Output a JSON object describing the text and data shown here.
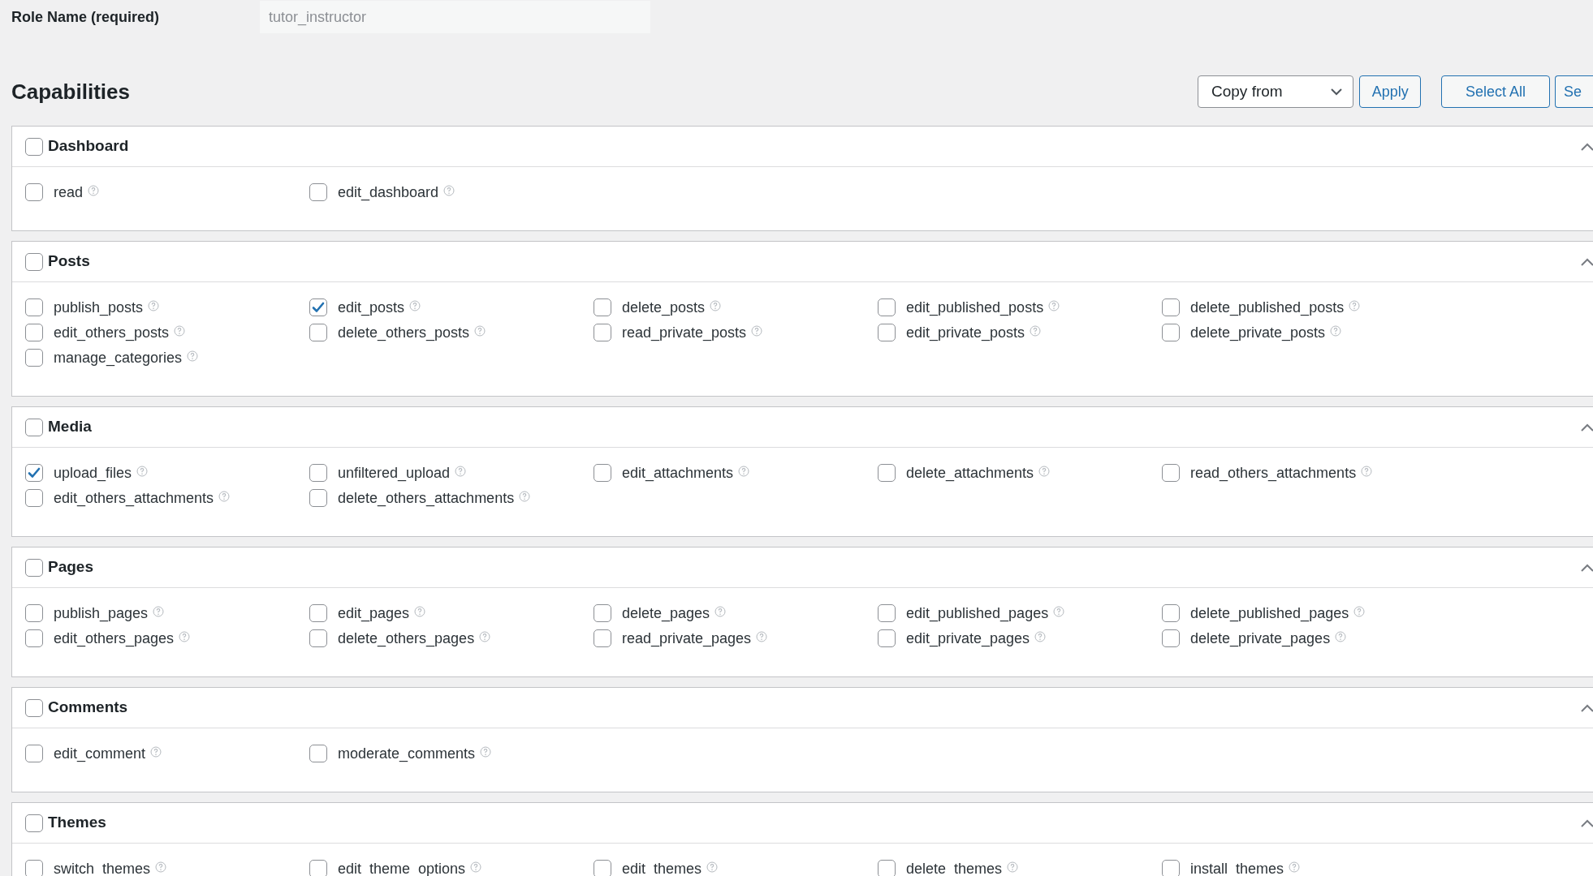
{
  "role_name": {
    "label": "Role Name (required)",
    "placeholder": "tutor_instructor"
  },
  "capabilities": {
    "title": "Capabilities",
    "copy_from": "Copy from",
    "apply": "Apply",
    "select_all": "Select All",
    "button_4": "Se"
  },
  "groups": [
    {
      "title": "Dashboard",
      "checked": false,
      "expanded": true,
      "items": [
        {
          "label": "read",
          "checked": false
        },
        {
          "label": "edit_dashboard",
          "checked": false
        }
      ]
    },
    {
      "title": "Posts",
      "checked": false,
      "expanded": true,
      "items": [
        {
          "label": "publish_posts",
          "checked": false
        },
        {
          "label": "edit_posts",
          "checked": true
        },
        {
          "label": "delete_posts",
          "checked": false
        },
        {
          "label": "edit_published_posts",
          "checked": false
        },
        {
          "label": "delete_published_posts",
          "checked": false
        },
        {
          "label": "edit_others_posts",
          "checked": false
        },
        {
          "label": "delete_others_posts",
          "checked": false
        },
        {
          "label": "read_private_posts",
          "checked": false
        },
        {
          "label": "edit_private_posts",
          "checked": false
        },
        {
          "label": "delete_private_posts",
          "checked": false
        },
        {
          "label": "manage_categories",
          "checked": false
        }
      ]
    },
    {
      "title": "Media",
      "checked": false,
      "expanded": true,
      "items": [
        {
          "label": "upload_files",
          "checked": true
        },
        {
          "label": "unfiltered_upload",
          "checked": false
        },
        {
          "label": "edit_attachments",
          "checked": false
        },
        {
          "label": "delete_attachments",
          "checked": false
        },
        {
          "label": "read_others_attachments",
          "checked": false
        },
        {
          "label": "edit_others_attachments",
          "checked": false
        },
        {
          "label": "delete_others_attachments",
          "checked": false
        }
      ]
    },
    {
      "title": "Pages",
      "checked": false,
      "expanded": true,
      "items": [
        {
          "label": "publish_pages",
          "checked": false
        },
        {
          "label": "edit_pages",
          "checked": false
        },
        {
          "label": "delete_pages",
          "checked": false
        },
        {
          "label": "edit_published_pages",
          "checked": false
        },
        {
          "label": "delete_published_pages",
          "checked": false
        },
        {
          "label": "edit_others_pages",
          "checked": false
        },
        {
          "label": "delete_others_pages",
          "checked": false
        },
        {
          "label": "read_private_pages",
          "checked": false
        },
        {
          "label": "edit_private_pages",
          "checked": false
        },
        {
          "label": "delete_private_pages",
          "checked": false
        }
      ]
    },
    {
      "title": "Comments",
      "checked": false,
      "expanded": true,
      "items": [
        {
          "label": "edit_comment",
          "checked": false
        },
        {
          "label": "moderate_comments",
          "checked": false
        }
      ]
    },
    {
      "title": "Themes",
      "checked": false,
      "expanded": true,
      "items": [
        {
          "label": "switch_themes",
          "checked": false
        },
        {
          "label": "edit_theme_options",
          "checked": false
        },
        {
          "label": "edit_themes",
          "checked": false
        },
        {
          "label": "delete_themes",
          "checked": false
        },
        {
          "label": "install_themes",
          "checked": false
        }
      ]
    }
  ]
}
